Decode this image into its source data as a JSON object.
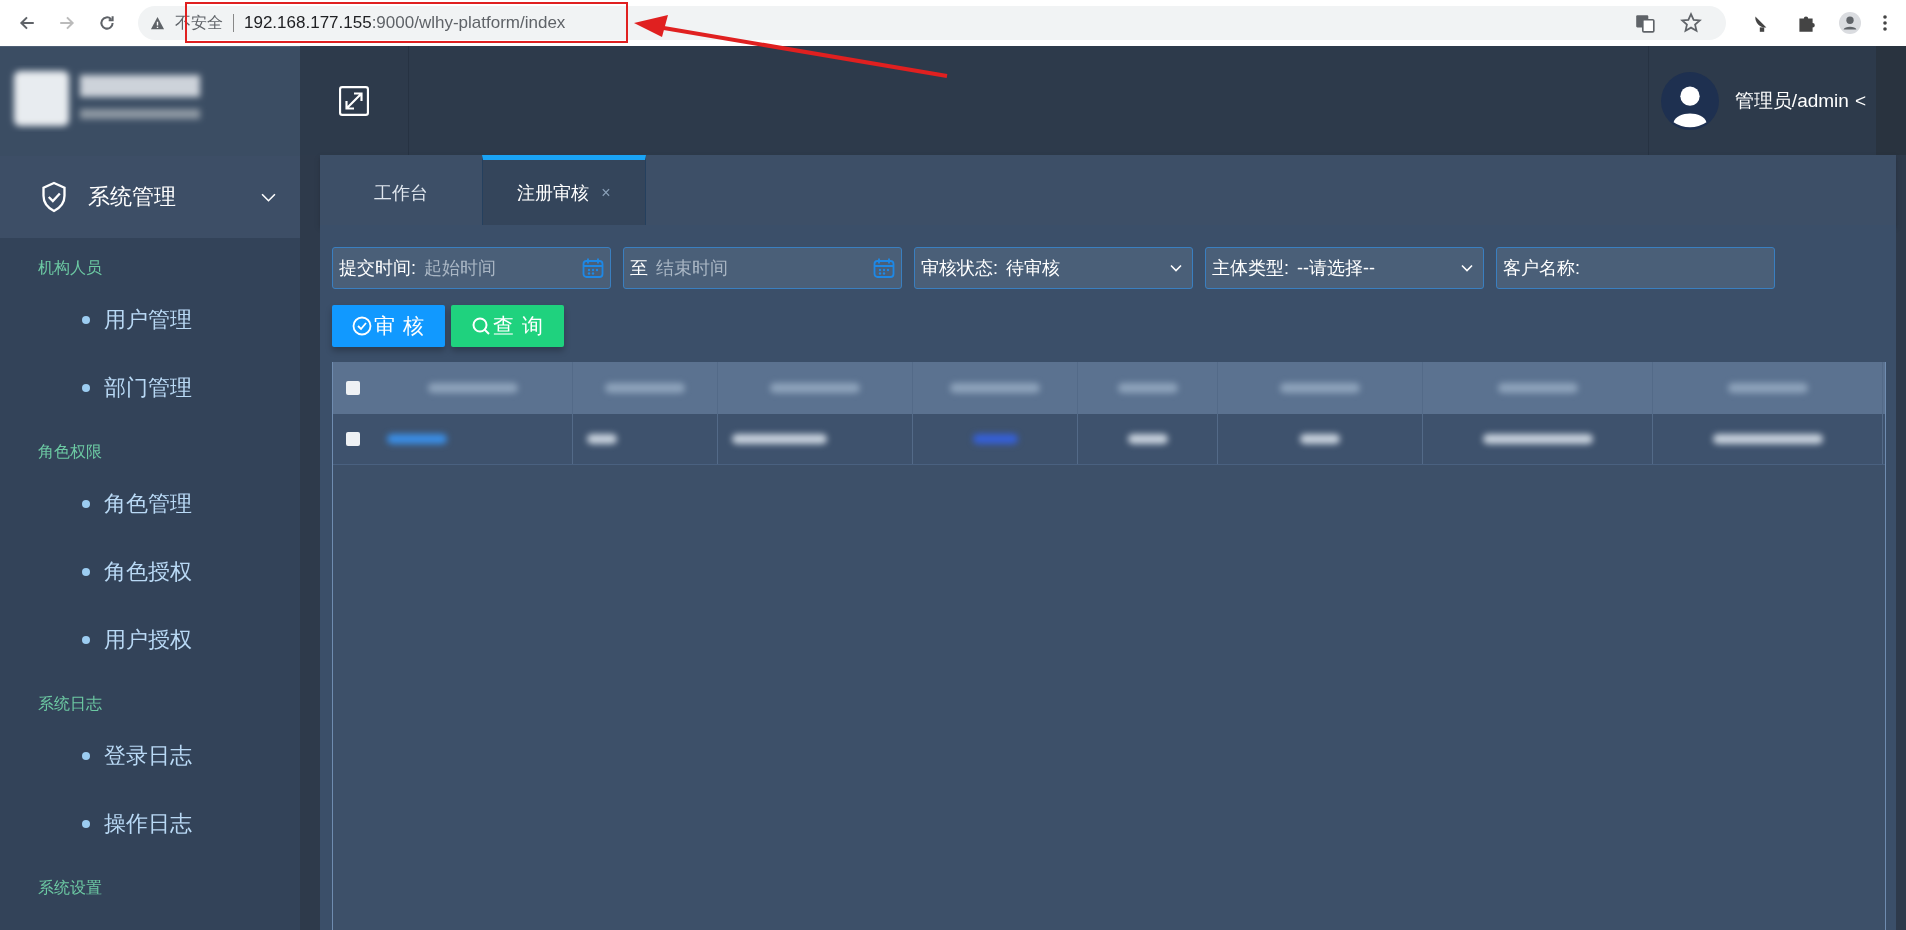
{
  "browser": {
    "security": "不安全",
    "host": "192.168.177.155",
    "path": ":9000/wlhy-platform/index"
  },
  "header": {
    "user": "管理员/admin",
    "caret": "<"
  },
  "sidebar": {
    "section": {
      "label": "系统管理",
      "expanded": true
    },
    "groups": [
      {
        "label": "机构人员",
        "items": [
          "用户管理",
          "部门管理"
        ]
      },
      {
        "label": "角色权限",
        "items": [
          "角色管理",
          "角色授权",
          "用户授权"
        ]
      },
      {
        "label": "系统日志",
        "items": [
          "登录日志",
          "操作日志"
        ]
      },
      {
        "label": "系统设置"
      }
    ]
  },
  "tabs": [
    {
      "label": "工作台",
      "selected": false
    },
    {
      "label": "注册审核",
      "selected": true,
      "close": "×"
    }
  ],
  "filters": [
    {
      "kind": "date",
      "label": "提交时间:",
      "placeholder": "起始时间"
    },
    {
      "kind": "date",
      "label": "至",
      "placeholder": "结束时间"
    },
    {
      "kind": "select",
      "label": "审核状态:",
      "value": "待审核"
    },
    {
      "kind": "select",
      "label": "主体类型:",
      "value": "--请选择--"
    },
    {
      "kind": "text",
      "label": "客户名称:"
    }
  ],
  "buttons": [
    {
      "kind": "audit",
      "label": "审 核"
    },
    {
      "kind": "search",
      "label": "查 询"
    }
  ],
  "table": {
    "header_checked": false,
    "rows": [
      {
        "checked": false
      }
    ]
  },
  "annotation": {
    "kind": "box-arrow"
  }
}
